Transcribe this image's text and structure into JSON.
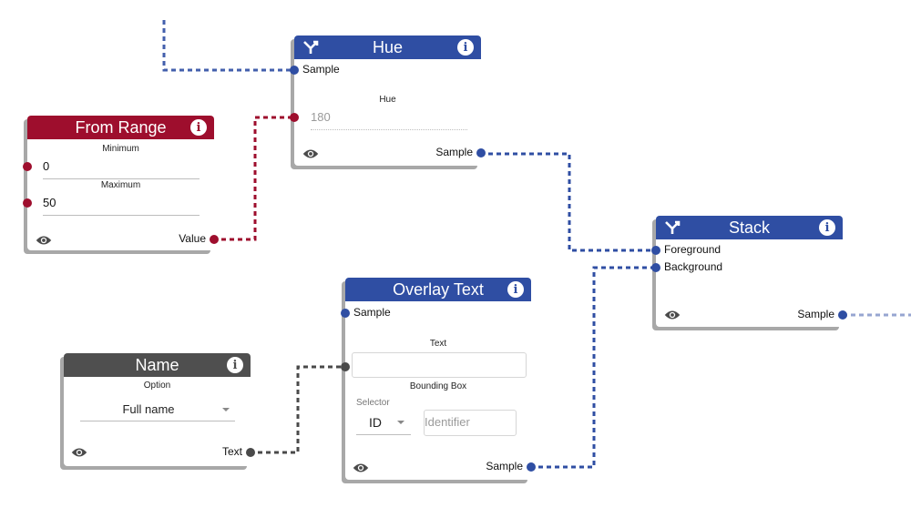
{
  "colors": {
    "sample_port": "#2f4ea3",
    "number_port": "#9e0e2d",
    "text_port": "#4a4a4a",
    "blue_header": "#2f4ea3",
    "red_header": "#9e0e2d",
    "gray_header": "#4f4f4f"
  },
  "nodes": {
    "hue": {
      "title": "Hue",
      "header_icon": "merge-icon",
      "info_icon": "info-icon",
      "inputs": [
        "Sample"
      ],
      "field_label": "Hue",
      "field_placeholder": "180",
      "output": "Sample",
      "preview_icon": "eye-icon"
    },
    "from_range": {
      "title": "From Range",
      "info_icon": "info-icon",
      "fields": [
        {
          "label": "Minimum",
          "value": "0"
        },
        {
          "label": "Maximum",
          "value": "50"
        }
      ],
      "output": "Value",
      "preview_icon": "eye-icon"
    },
    "stack": {
      "title": "Stack",
      "header_icon": "merge-icon",
      "info_icon": "info-icon",
      "inputs": [
        "Foreground",
        "Background"
      ],
      "output": "Sample",
      "preview_icon": "eye-icon"
    },
    "overlay_text": {
      "title": "Overlay Text",
      "info_icon": "info-icon",
      "inputs": [
        "Sample"
      ],
      "text_label": "Text",
      "text_value": "",
      "bounding_box_label": "Bounding Box",
      "selector_label": "Selector",
      "selector_value": "ID",
      "identifier_placeholder": "Identifier",
      "output": "Sample",
      "preview_icon": "eye-icon"
    },
    "name": {
      "title": "Name",
      "info_icon": "info-icon",
      "option_label": "Option",
      "option_value": "Full name",
      "output": "Text",
      "preview_icon": "eye-icon"
    }
  }
}
